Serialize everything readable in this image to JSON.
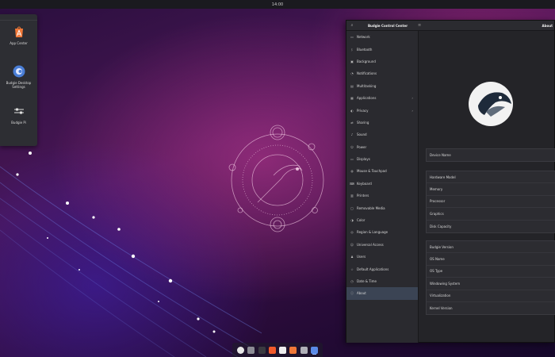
{
  "top_panel": {
    "clock": "14:00"
  },
  "app_menu": {
    "items": [
      {
        "label": "App Center",
        "icon": "app-center-icon"
      },
      {
        "label": "Budgie Desktop Settings",
        "icon": "budgie-settings-icon"
      },
      {
        "label": "Budgie Pi",
        "icon": "sliders-icon"
      }
    ]
  },
  "control_center": {
    "title": "Budgie Control Center",
    "page_title": "About",
    "sidebar": [
      {
        "label": "Network",
        "icon": "network-icon"
      },
      {
        "label": "Bluetooth",
        "icon": "bluetooth-icon"
      },
      {
        "label": "Background",
        "icon": "background-icon"
      },
      {
        "label": "Notifications",
        "icon": "notifications-icon"
      },
      {
        "label": "Multitasking",
        "icon": "multitasking-icon"
      },
      {
        "label": "Applications",
        "icon": "applications-icon",
        "chevron": true
      },
      {
        "label": "Privacy",
        "icon": "privacy-icon",
        "chevron": true
      },
      {
        "label": "Sharing",
        "icon": "sharing-icon"
      },
      {
        "label": "Sound",
        "icon": "sound-icon"
      },
      {
        "label": "Power",
        "icon": "power-icon"
      },
      {
        "label": "Displays",
        "icon": "displays-icon"
      },
      {
        "label": "Mouse & Touchpad",
        "icon": "mouse-icon"
      },
      {
        "label": "Keyboard",
        "icon": "keyboard-icon"
      },
      {
        "label": "Printers",
        "icon": "printer-icon"
      },
      {
        "label": "Removable Media",
        "icon": "removable-media-icon"
      },
      {
        "label": "Color",
        "icon": "color-icon"
      },
      {
        "label": "Region & Language",
        "icon": "region-icon"
      },
      {
        "label": "Universal Access",
        "icon": "accessibility-icon"
      },
      {
        "label": "Users",
        "icon": "users-icon"
      },
      {
        "label": "Default Applications",
        "icon": "default-apps-icon"
      },
      {
        "label": "Date & Time",
        "icon": "clock-icon"
      },
      {
        "label": "About",
        "icon": "info-icon",
        "active": true
      }
    ],
    "device_name_label": "Device Name",
    "hardware": [
      "Hardware Model",
      "Memory",
      "Processor",
      "Graphics",
      "Disk Capacity"
    ],
    "software": [
      "Budgie Version",
      "OS Name",
      "OS Type",
      "Windowing System",
      "Virtualization",
      "Kernel Version"
    ]
  },
  "dock": {
    "items": [
      {
        "icon": "budgie-menu-icon",
        "color": "#e8e8e8"
      },
      {
        "icon": "files-icon",
        "color": "#8c8c95"
      },
      {
        "icon": "terminal-icon",
        "color": "#3a3a40"
      },
      {
        "icon": "brave-icon",
        "color": "#f25a2b"
      },
      {
        "icon": "text-editor-icon",
        "color": "#eeeeee"
      },
      {
        "icon": "app-center-icon",
        "color": "#f07838"
      },
      {
        "icon": "settings-icon",
        "color": "#b0b0b8"
      },
      {
        "icon": "control-center-icon",
        "color": "#5a8ae6",
        "active": true
      }
    ]
  },
  "colors": {
    "accent": "#3b4454",
    "window_bg": "#242428"
  }
}
